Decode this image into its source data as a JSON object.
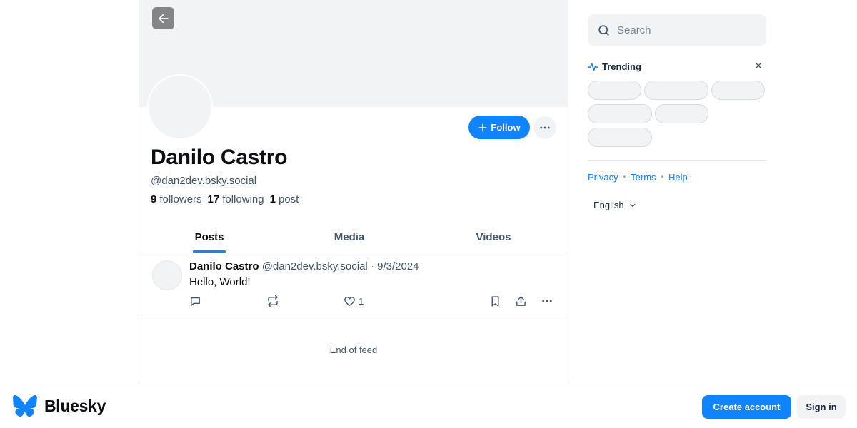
{
  "profile": {
    "display_name": "Danilo Castro",
    "handle": "@dan2dev.bsky.social",
    "follow_label": "Follow",
    "stats": {
      "followers_count": "9",
      "followers_label": "followers",
      "following_count": "17",
      "following_label": "following",
      "posts_count": "1",
      "posts_label": "post"
    }
  },
  "tabs": [
    {
      "label": "Posts",
      "active": true
    },
    {
      "label": "Media",
      "active": false
    },
    {
      "label": "Videos",
      "active": false
    }
  ],
  "post": {
    "author_name": "Danilo Castro",
    "author_handle": "@dan2dev.bsky.social",
    "separator": "·",
    "date": "9/3/2024",
    "text": "Hello, World!",
    "like_count": "1"
  },
  "feed": {
    "end_label": "End of feed"
  },
  "sidebar": {
    "search_placeholder": "Search",
    "trending_title": "Trending",
    "footer_links": [
      "Privacy",
      "Terms",
      "Help"
    ],
    "language": "English"
  },
  "bottom_bar": {
    "brand": "Bluesky",
    "create_account_label": "Create account",
    "sign_in_label": "Sign in"
  },
  "colors": {
    "accent": "#1083fe",
    "muted_text": "#42576c",
    "surface": "#f1f3f5"
  }
}
